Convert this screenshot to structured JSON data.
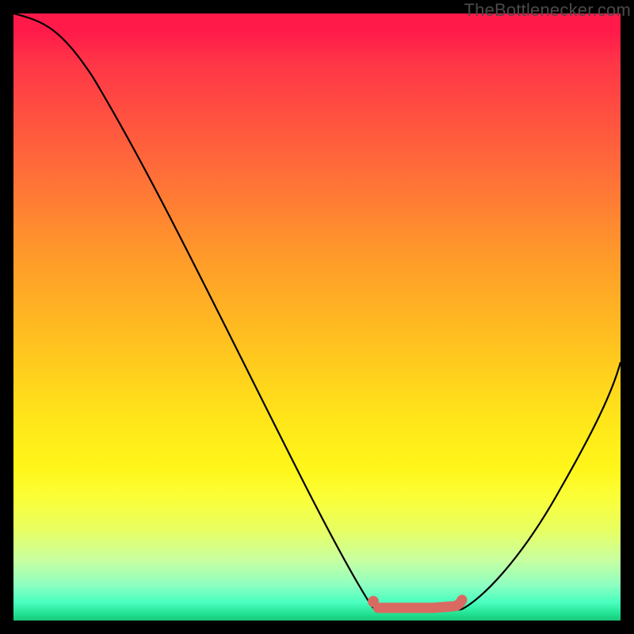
{
  "watermark": "TheBottlenecker.com",
  "chart_data": {
    "type": "line",
    "title": "",
    "xlabel": "",
    "ylabel": "",
    "xlim": [
      0,
      100
    ],
    "ylim": [
      0,
      100
    ],
    "gradient_background": {
      "top_color": "#ff1a4a",
      "mid_color": "#ffe61a",
      "bottom_color": "#20e090",
      "meaning": "red=high bottleneck, green=low bottleneck"
    },
    "series": [
      {
        "name": "left-descending-curve",
        "x": [
          0,
          6,
          15,
          25,
          35,
          45,
          53,
          57,
          59.5
        ],
        "y": [
          100,
          99,
          90,
          73,
          55,
          36,
          18,
          8,
          2
        ]
      },
      {
        "name": "right-ascending-curve",
        "x": [
          74,
          78,
          84,
          90,
          96,
          100
        ],
        "y": [
          2,
          6,
          14,
          24,
          36,
          44
        ]
      }
    ],
    "flat_region": {
      "x_start": 59,
      "x_end": 74,
      "y": 2,
      "note": "optimal / zero-bottleneck zone"
    },
    "marker": {
      "dot": {
        "x": 59.5,
        "y": 3.2
      },
      "segment": {
        "x_start": 60,
        "x_end": 74,
        "y": 2.2
      }
    }
  }
}
